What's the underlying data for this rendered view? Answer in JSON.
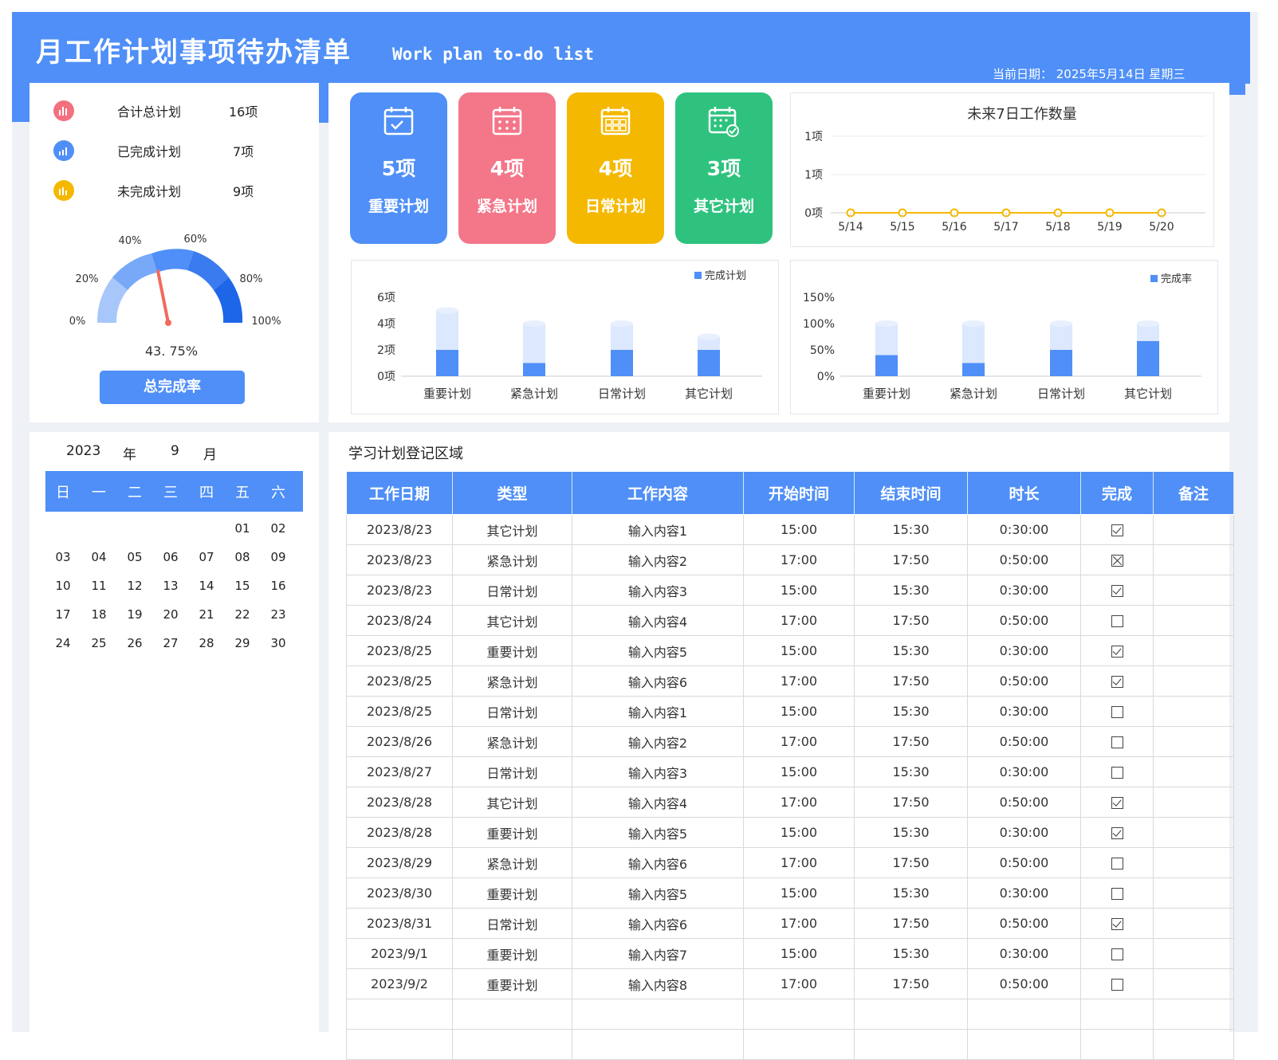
{
  "header": {
    "title": "月工作计划事项待办清单",
    "subtitle": "Work plan to-do list",
    "current_date": "当前日期： 2025年5月14日 星期三"
  },
  "summary": {
    "items": [
      {
        "label": "合计总计划",
        "value": "16项",
        "icon": "bar-chart-icon",
        "color": "#f4707f"
      },
      {
        "label": "已完成计划",
        "value": "7项",
        "icon": "growth-chart-icon",
        "color": "#4f8ff7"
      },
      {
        "label": "未完成计划",
        "value": "9项",
        "icon": "bar-chart-icon",
        "color": "#f5b800"
      }
    ],
    "gauge": {
      "ticks": [
        "0%",
        "20%",
        "40%",
        "60%",
        "80%",
        "100%"
      ],
      "value_text": "43. 75%",
      "value": 0.4375
    },
    "rate_button": "总完成率"
  },
  "cards": [
    {
      "value": "5项",
      "label": "重要计划",
      "color": "#4f8ff7",
      "icon": "calendar-check-icon"
    },
    {
      "value": "4项",
      "label": "紧急计划",
      "color": "#f47689",
      "icon": "calendar-grid-icon"
    },
    {
      "value": "4项",
      "label": "日常计划",
      "color": "#f5b800",
      "icon": "calendar-list-icon"
    },
    {
      "value": "3项",
      "label": "其它计划",
      "color": "#2ec27e",
      "icon": "calendar-done-icon"
    }
  ],
  "chart_data": [
    {
      "type": "line",
      "title": "未来7日工作数量",
      "x": [
        "5/14",
        "5/15",
        "5/16",
        "5/17",
        "5/18",
        "5/19",
        "5/20"
      ],
      "values": [
        0,
        0,
        0,
        0,
        0,
        0,
        0
      ],
      "y_ticks": [
        "1项",
        "1项",
        "0项"
      ],
      "color": "#f5b800"
    },
    {
      "type": "bar",
      "categories": [
        "重要计划",
        "紧急计划",
        "日常计划",
        "其它计划"
      ],
      "series": [
        {
          "name": "",
          "values": [
            5,
            4,
            4,
            3
          ]
        },
        {
          "name": "完成计划",
          "values": [
            2,
            1,
            2,
            2
          ]
        }
      ],
      "y_ticks": [
        "6项",
        "4项",
        "2项",
        "0项"
      ],
      "ylim": [
        0,
        6
      ],
      "legend": "top-right"
    },
    {
      "type": "bar",
      "categories": [
        "重要计划",
        "紧急计划",
        "日常计划",
        "其它计划"
      ],
      "series": [
        {
          "name": "",
          "values": [
            100,
            100,
            100,
            100
          ]
        },
        {
          "name": "完成率",
          "values": [
            40,
            25,
            50,
            66.7
          ]
        }
      ],
      "y_ticks": [
        "150%",
        "100%",
        "50%",
        "0%"
      ],
      "ylim": [
        0,
        150
      ],
      "legend": "top-right"
    }
  ],
  "calendar": {
    "year": "2023",
    "year_unit": "年",
    "month": "9",
    "month_unit": "月",
    "weekdays": [
      "日",
      "一",
      "二",
      "三",
      "四",
      "五",
      "六"
    ],
    "weeks": [
      [
        "",
        "",
        "",
        "",
        "",
        "01",
        "02"
      ],
      [
        "03",
        "04",
        "05",
        "06",
        "07",
        "08",
        "09"
      ],
      [
        "10",
        "11",
        "12",
        "13",
        "14",
        "15",
        "16"
      ],
      [
        "17",
        "18",
        "19",
        "20",
        "21",
        "22",
        "23"
      ],
      [
        "24",
        "25",
        "26",
        "27",
        "28",
        "29",
        "30"
      ]
    ]
  },
  "table": {
    "title": "学习计划登记区域",
    "headers": [
      "工作日期",
      "类型",
      "工作内容",
      "开始时间",
      "结束时间",
      "时长",
      "完成",
      "备注"
    ],
    "rows": [
      [
        "2023/8/23",
        "其它计划",
        "输入内容1",
        "15:00",
        "15:30",
        "0:30:00",
        "checked",
        ""
      ],
      [
        "2023/8/23",
        "紧急计划",
        "输入内容2",
        "17:00",
        "17:50",
        "0:50:00",
        "crossed",
        ""
      ],
      [
        "2023/8/23",
        "日常计划",
        "输入内容3",
        "15:00",
        "15:30",
        "0:30:00",
        "checked",
        ""
      ],
      [
        "2023/8/24",
        "其它计划",
        "输入内容4",
        "17:00",
        "17:50",
        "0:50:00",
        "unchecked",
        ""
      ],
      [
        "2023/8/25",
        "重要计划",
        "输入内容5",
        "15:00",
        "15:30",
        "0:30:00",
        "checked",
        ""
      ],
      [
        "2023/8/25",
        "紧急计划",
        "输入内容6",
        "17:00",
        "17:50",
        "0:50:00",
        "checked",
        ""
      ],
      [
        "2023/8/25",
        "日常计划",
        "输入内容1",
        "15:00",
        "15:30",
        "0:30:00",
        "unchecked",
        ""
      ],
      [
        "2023/8/26",
        "紧急计划",
        "输入内容2",
        "17:00",
        "17:50",
        "0:50:00",
        "unchecked",
        ""
      ],
      [
        "2023/8/27",
        "日常计划",
        "输入内容3",
        "15:00",
        "15:30",
        "0:30:00",
        "unchecked",
        ""
      ],
      [
        "2023/8/28",
        "其它计划",
        "输入内容4",
        "17:00",
        "17:50",
        "0:50:00",
        "checked",
        ""
      ],
      [
        "2023/8/28",
        "重要计划",
        "输入内容5",
        "15:00",
        "15:30",
        "0:30:00",
        "checked",
        ""
      ],
      [
        "2023/8/29",
        "紧急计划",
        "输入内容6",
        "17:00",
        "17:50",
        "0:50:00",
        "unchecked",
        ""
      ],
      [
        "2023/8/30",
        "重要计划",
        "输入内容5",
        "15:00",
        "15:30",
        "0:30:00",
        "unchecked",
        ""
      ],
      [
        "2023/8/31",
        "日常计划",
        "输入内容6",
        "17:00",
        "17:50",
        "0:50:00",
        "checked",
        ""
      ],
      [
        "2023/9/1",
        "重要计划",
        "输入内容7",
        "15:00",
        "15:30",
        "0:30:00",
        "unchecked",
        ""
      ],
      [
        "2023/9/2",
        "重要计划",
        "输入内容8",
        "17:00",
        "17:50",
        "0:50:00",
        "unchecked",
        ""
      ],
      [
        "",
        "",
        "",
        "",
        "",
        "",
        "",
        ""
      ],
      [
        "",
        "",
        "",
        "",
        "",
        "",
        "",
        ""
      ]
    ]
  }
}
